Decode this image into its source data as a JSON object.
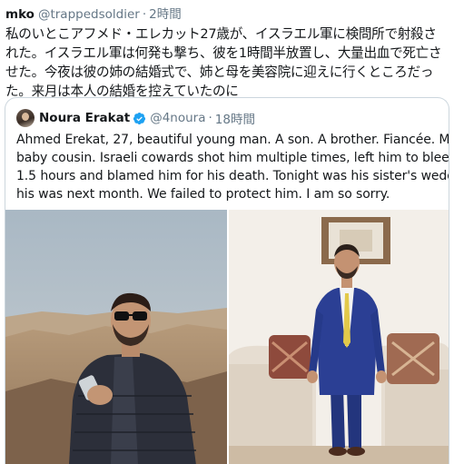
{
  "tweet": {
    "author_name": "mko",
    "author_handle": "@trappedsoldier",
    "separator": "·",
    "time": "2時間",
    "text_lines": [
      "私のいとこアフメド・エレカット27歳が、イスラエル軍に検問所で射殺さ",
      "れた。イスラエル軍は何発も撃ち、彼を1時間半放置し、大量出血で死亡さ",
      "せた。今夜は彼の姉の結婚式で、姉と母を美容院に迎えに行くところだっ",
      "た。来月は本人の結婚を控えていたのに"
    ]
  },
  "quoted": {
    "author_name": "Noura Erakat",
    "verified_icon": "verified-badge-icon",
    "author_handle": "@4noura",
    "separator": "·",
    "time": "18時間",
    "text_lines": [
      "Ahmed Erekat, 27, beautiful young man. A son. A brother. Fiancée. My",
      "baby cousin. Israeli cowards shot him multiple times, left him to bleed for",
      "1.5 hours and blamed him for his death. Tonight was his sister's wedding,",
      "his was next month. We failed to protect him. I am so sorry."
    ],
    "photos": [
      "photo-man-desert-overlook",
      "photo-man-blue-suit-indoors"
    ]
  },
  "colors": {
    "text": "#14171a",
    "secondary": "#657786",
    "border": "#ccd6dd",
    "verified": "#1da1f2"
  }
}
